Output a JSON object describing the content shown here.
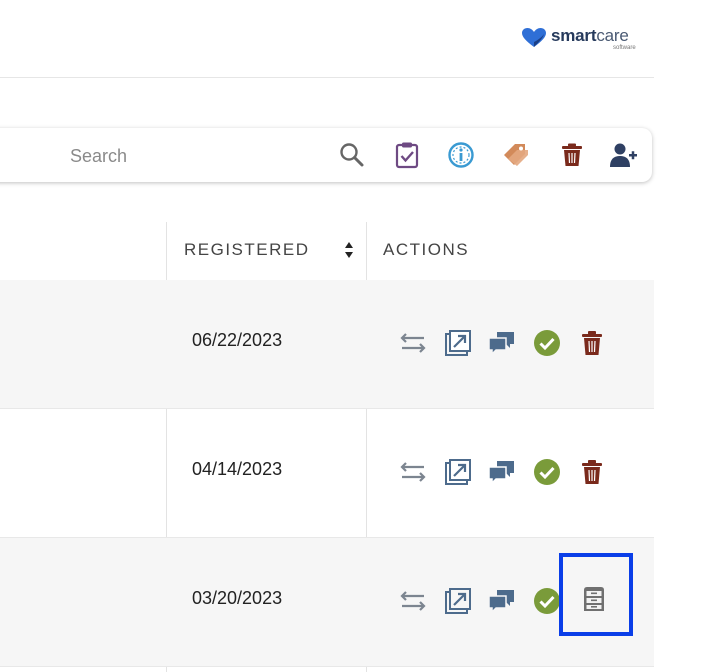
{
  "header": {
    "logo_brand_main": "smart",
    "logo_brand_accent": "care",
    "logo_sub": "software"
  },
  "toolbar": {
    "search_placeholder": "Search",
    "icons": [
      "search-icon",
      "clipboard-check-icon",
      "info-gauge-icon",
      "tags-icon",
      "trash-icon",
      "add-user-icon"
    ]
  },
  "table": {
    "columns": [
      {
        "label": "REGISTERED",
        "sortable": true
      },
      {
        "label": "ACTIONS",
        "sortable": false
      }
    ],
    "rows": [
      {
        "registered": "06/22/2023",
        "actions": [
          "transfer-icon",
          "open-external-icon",
          "comments-icon",
          "approve-check-icon",
          "trash-icon"
        ]
      },
      {
        "registered": "04/14/2023",
        "actions": [
          "transfer-icon",
          "open-external-icon",
          "comments-icon",
          "approve-check-icon",
          "trash-icon"
        ]
      },
      {
        "registered": "03/20/2023",
        "actions": [
          "transfer-icon",
          "open-external-icon",
          "comments-icon",
          "approve-check-icon",
          "archive-cabinet-icon"
        ]
      }
    ]
  },
  "colors": {
    "brand_navy": "#263a5c",
    "brand_heart": "#2f6fd6",
    "clipboard_purple": "#6e4a83",
    "info_blue": "#3a9ad2",
    "tag_orange": "#d28a5a",
    "trash_maroon": "#7a2a1c",
    "user_navy": "#2f4063",
    "action_gray": "#7c8590",
    "action_slate": "#4d6b8c",
    "approve_green": "#7a9b3a",
    "highlight_blue": "#0a3ee8"
  }
}
